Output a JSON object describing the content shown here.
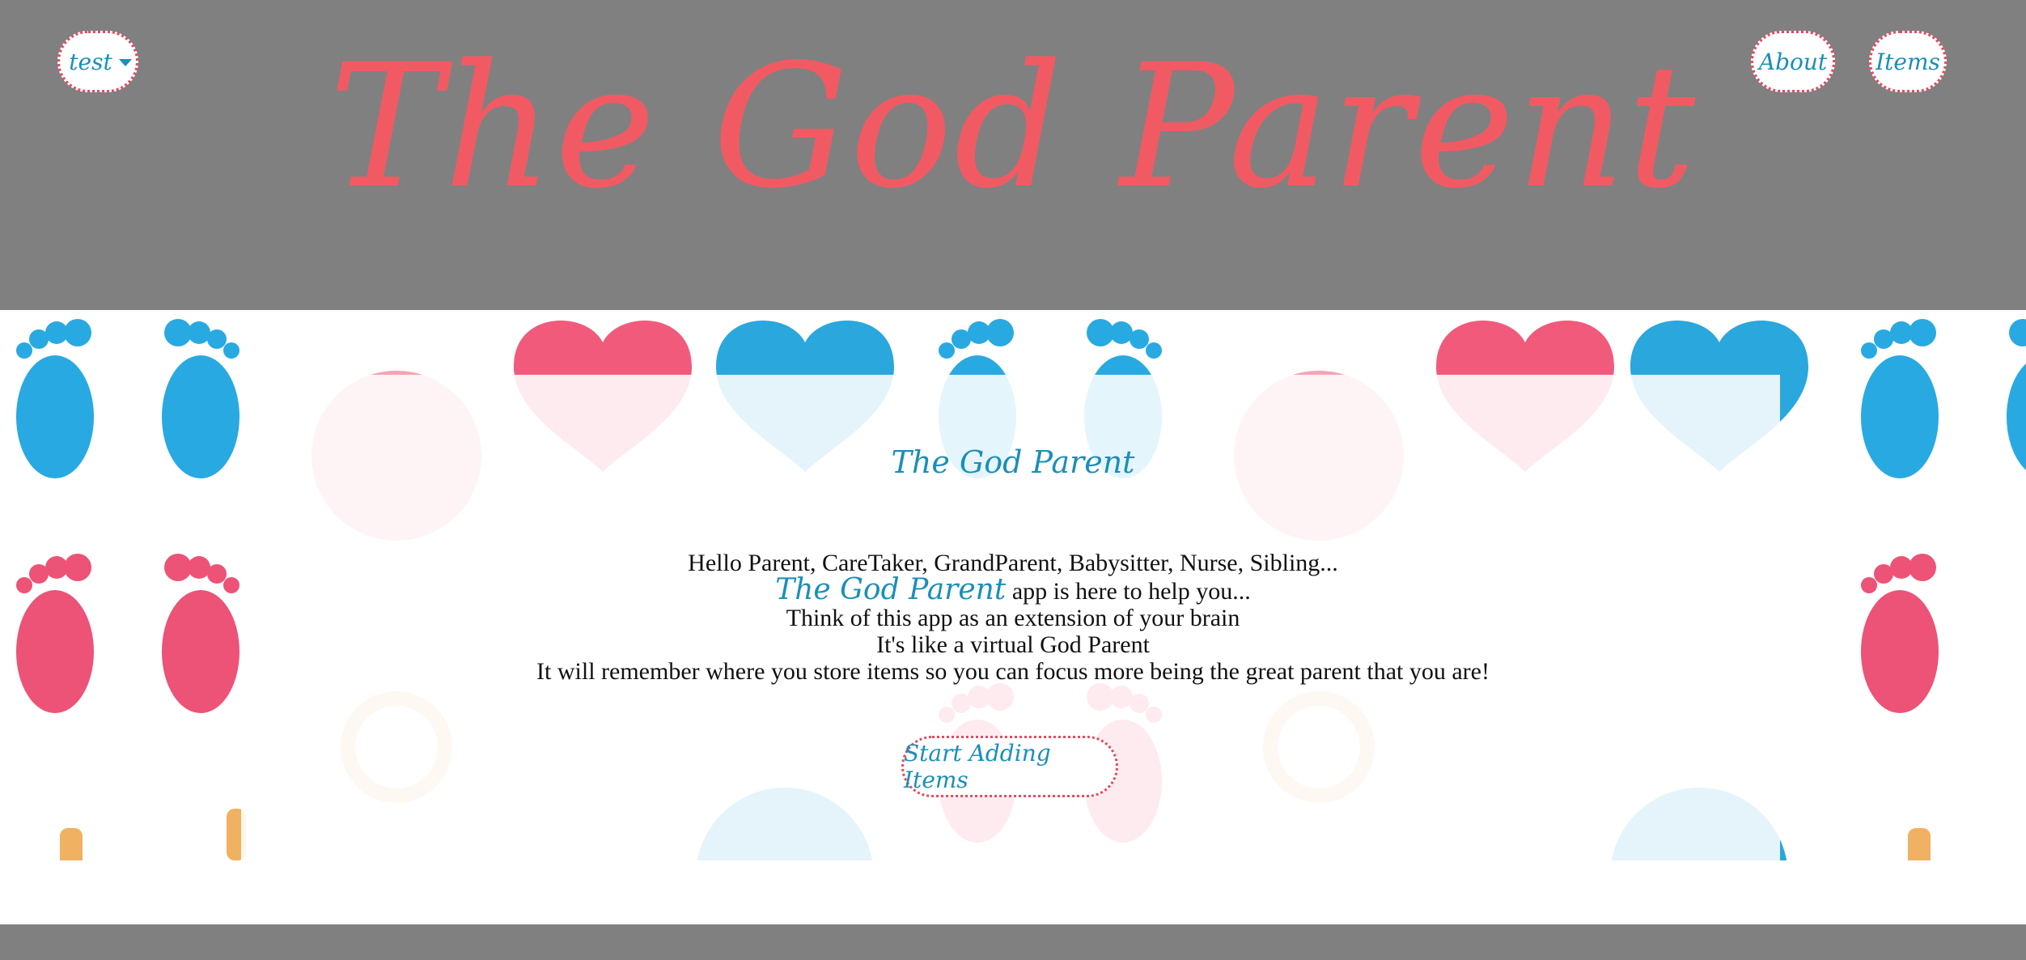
{
  "header": {
    "user_menu_label": "test",
    "nav": {
      "about_label": "About",
      "items_label": "Items"
    },
    "site_title": "The God Parent"
  },
  "main": {
    "card_title": "The God Parent",
    "line1": "Hello Parent, CareTaker, GrandParent, Babysitter, Nurse, Sibling...",
    "line2_brand": "The God Parent",
    "line2_rest": " app is here to help you...",
    "line3": "Think of this app as an extension of your brain",
    "line4": "It's like a virtual God Parent",
    "line5": "It will remember where you store items so you can focus more being the great parent that you are!",
    "start_button_label": "Start Adding Items"
  },
  "colors": {
    "header_bg": "#808080",
    "title_coral": "#f25a63",
    "teal_text": "#1a8fb8",
    "dotted_border": "#e8485f",
    "foot_blue": "#29a9e1",
    "foot_pink": "#ec5377"
  }
}
